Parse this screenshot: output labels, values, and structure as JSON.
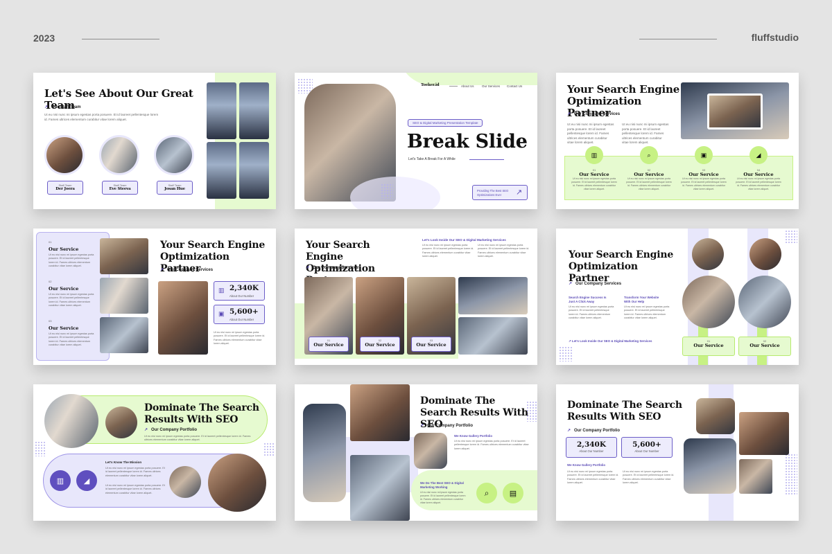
{
  "header": {
    "year": "2023",
    "brand": "fluffstudio"
  },
  "colors": {
    "lime": "#c7f184",
    "lime_light": "#e6fad0",
    "lavender": "#e8e7fb",
    "purple": "#5f4fbf",
    "background": "#e4e4e4"
  },
  "lorem": "Ut eu nisi nunc mi ipsum egestas porta posuere. Et id laoreet pellentesque lorem id. Fames ultrices elementum curabitur vitae lorem aliquet.",
  "slide1": {
    "title": "Let's See About Our Great Team",
    "subtitle": "Our Staff Team",
    "members": [
      {
        "role": "Staff Team",
        "name": "Der Joera"
      },
      {
        "role": "Staff Team",
        "name": "Eve Steeva"
      },
      {
        "role": "Staff Team",
        "name": "Josan Hue"
      }
    ]
  },
  "slide2": {
    "brand": "Toeker.id",
    "nav": [
      "About Us",
      "Our Services",
      "Contact Us"
    ],
    "tag": "SEO & Digital Marketing Presentation Template",
    "title": "Break Slide",
    "subtitle": "Let's Take A Break For A While",
    "cta": "Providing The Best SEO Optimizations Ever",
    "cta_icon": "arrow-up-right-icon"
  },
  "slide3": {
    "title": "Your Search Engine Optimization Partner",
    "subtitle": "Our Company Services",
    "services": [
      {
        "num": "01",
        "label": "Our Service",
        "icon": "chart-icon",
        "glyph": "▥"
      },
      {
        "num": "02",
        "label": "Our Service",
        "icon": "search-icon",
        "glyph": "⌕"
      },
      {
        "num": "03",
        "label": "Our Service",
        "icon": "chip-icon",
        "glyph": "▣"
      },
      {
        "num": "04",
        "label": "Our Service",
        "icon": "megaphone-icon",
        "glyph": "◢"
      }
    ]
  },
  "slide4": {
    "title": "Your Search Engine Optimization Partner",
    "subtitle": "Our Company Services",
    "list": [
      {
        "num": "01",
        "label": "Our Service"
      },
      {
        "num": "02",
        "label": "Our Service"
      },
      {
        "num": "03",
        "label": "Our Service"
      }
    ],
    "stats": [
      {
        "value": "2,340K",
        "label": "About Our Number"
      },
      {
        "value": "5,600+",
        "label": "About Our Number"
      }
    ]
  },
  "slide5": {
    "title": "Your Search Engine Optimization Partner",
    "subtitle": "Our Company Services",
    "kicker": "Let's Look Inside Our SEO & Digital Marketing Services",
    "services": [
      {
        "num": "01",
        "label": "Our Service"
      },
      {
        "num": "02",
        "label": "Our Service"
      },
      {
        "num": "03",
        "label": "Our Service"
      }
    ]
  },
  "slide6": {
    "title": "Your Search Engine Optimization Partner",
    "subtitle": "Our Company Services",
    "col1_title": "Search Engine Success Is Just A Click Away",
    "col2_title": "Transform Your Website With Our Help",
    "footer_link": "Let's Look Inside Our SEO & Digital Marketing Services",
    "services": [
      {
        "num": "01",
        "label": "Our Service"
      },
      {
        "num": "02",
        "label": "Our Service"
      }
    ]
  },
  "slide7": {
    "title": "Dominate The Search Results With SEO",
    "subtitle": "Our Company Portfolio",
    "mission_title": "Let's Know The Mission",
    "icons": [
      "chart-icon",
      "megaphone-icon"
    ]
  },
  "slide8": {
    "title": "Dominate The Search Results With SEO",
    "subtitle": "Our Company Portfolio",
    "kicker1": "We Know Gallery Portfolio",
    "kicker2": "We Do The Best SEO & Digital Marketing Working",
    "icons": [
      "search-icon",
      "document-icon"
    ]
  },
  "slide9": {
    "title": "Dominate The Search Results With SEO",
    "subtitle": "Our Company Portfolio",
    "stats": [
      {
        "value": "2,340K",
        "label": "About Our Number"
      },
      {
        "value": "5,600+",
        "label": "About Our Number"
      }
    ],
    "kicker": "We Know Gallery Portfolio"
  }
}
